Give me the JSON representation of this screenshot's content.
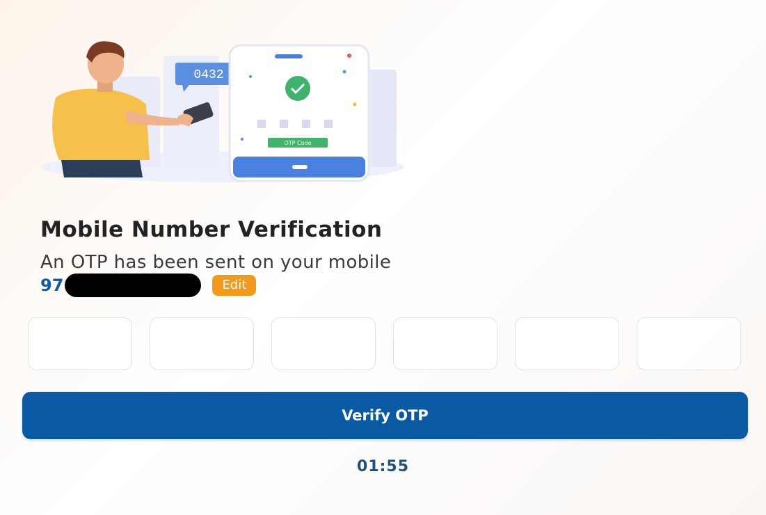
{
  "illustration": {
    "otp_bubble_digits": "0432",
    "phone_label": "OTP Code"
  },
  "verification": {
    "title": "Mobile Number Verification",
    "message": "An OTP has been sent on your mobile",
    "phone_prefix": "97",
    "edit_label": "Edit"
  },
  "otp": {
    "digits": [
      "",
      "",
      "",
      "",
      "",
      ""
    ]
  },
  "actions": {
    "verify_label": "Verify OTP"
  },
  "timer": {
    "countdown": "01:55"
  },
  "colors": {
    "primary": "#0a5aa3",
    "accent": "#f39a1c",
    "phone_number": "#0e5aa7"
  }
}
